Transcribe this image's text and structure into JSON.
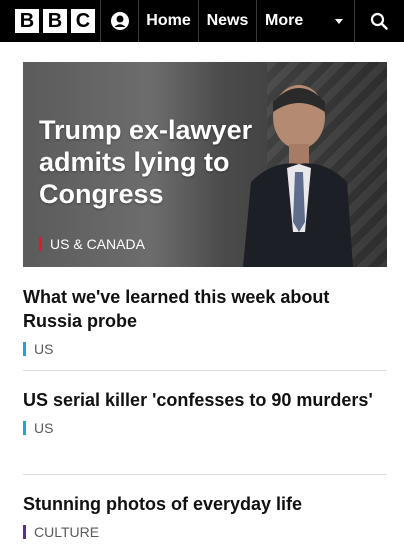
{
  "nav": {
    "logo_letters": [
      "B",
      "B",
      "C"
    ],
    "items": [
      {
        "label": "Home"
      },
      {
        "label": "News"
      },
      {
        "label": "More"
      }
    ],
    "icons": {
      "account": "account-icon",
      "dropdown": "caret-down-icon",
      "search": "search-icon"
    }
  },
  "hero": {
    "title": "Trump ex-lawyer admits lying to Congress",
    "tag": "US & CANADA",
    "tag_color": "#e01b22"
  },
  "stories": [
    {
      "title": "What we've learned this week about Russia probe",
      "tag": "US",
      "tag_color": "#2a9fd6"
    },
    {
      "title": "US serial killer 'confesses to 90 murders'",
      "tag": "US",
      "tag_color": "#2a9fd6"
    },
    {
      "title": "Stunning photos of everyday life",
      "tag": "CULTURE",
      "tag_color": "#5c2d91"
    }
  ]
}
